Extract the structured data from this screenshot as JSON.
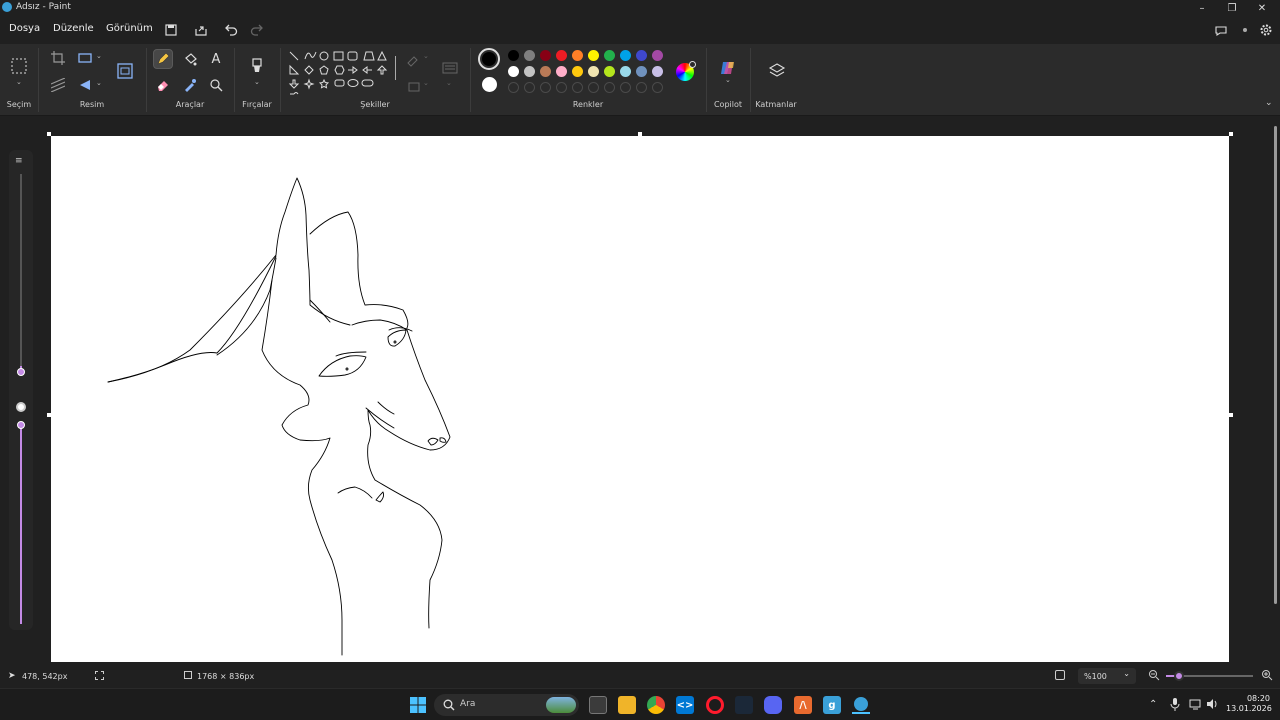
{
  "window": {
    "title": "Adsız - Paint"
  },
  "menu": {
    "file": "Dosya",
    "edit": "Düzenle",
    "view": "Görünüm"
  },
  "ribbon": {
    "groups": {
      "selection": "Seçim",
      "image": "Resim",
      "tools": "Araçlar",
      "brushes": "Fırçalar",
      "shapes": "Şekiller",
      "colors": "Renkler",
      "copilot": "Copilot",
      "layers": "Katmanlar"
    },
    "palette_row1": [
      "#000000",
      "#7f7f7f",
      "#880015",
      "#ed1c24",
      "#ff7f27",
      "#fff200",
      "#22b14c",
      "#00a2e8",
      "#3f48cc",
      "#a349a4"
    ],
    "palette_row2": [
      "#ffffff",
      "#c3c3c3",
      "#b97a57",
      "#ffaec9",
      "#ffc90e",
      "#efe4b0",
      "#b5e61d",
      "#99d9ea",
      "#7092be",
      "#c8bfe7"
    ],
    "color1": "#000000",
    "color2": "#ffffff"
  },
  "status": {
    "cursor_pos": "478, 542px",
    "canvas_size": "1768 × 836px",
    "zoom": "%100",
    "zoom_slider_fraction": 0.15
  },
  "taskbar": {
    "search_placeholder": "Ara",
    "time": "08:20",
    "date": "13.01.2026"
  }
}
